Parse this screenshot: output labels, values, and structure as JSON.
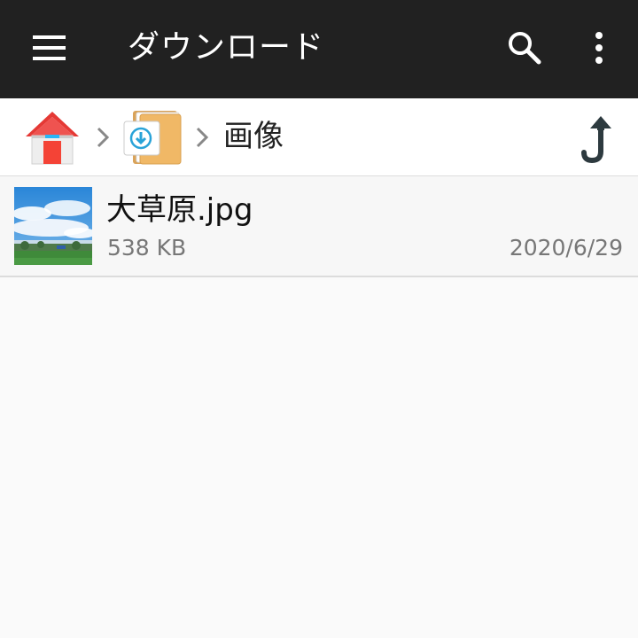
{
  "appbar": {
    "title": "ダウンロード",
    "background_color": "#212121",
    "icons": [
      "menu-icon",
      "search-icon",
      "more-vert-icon"
    ]
  },
  "breadcrumb": {
    "items": [
      {
        "icon": "home-icon"
      },
      {
        "icon": "download-folder-icon"
      }
    ],
    "current": "画像",
    "up_icon": "up-arrow-icon"
  },
  "files": [
    {
      "name": "大草原.jpg",
      "size": "538 KB",
      "date": "2020/6/29",
      "thumbnail": "landscape-thumbnail"
    }
  ]
}
